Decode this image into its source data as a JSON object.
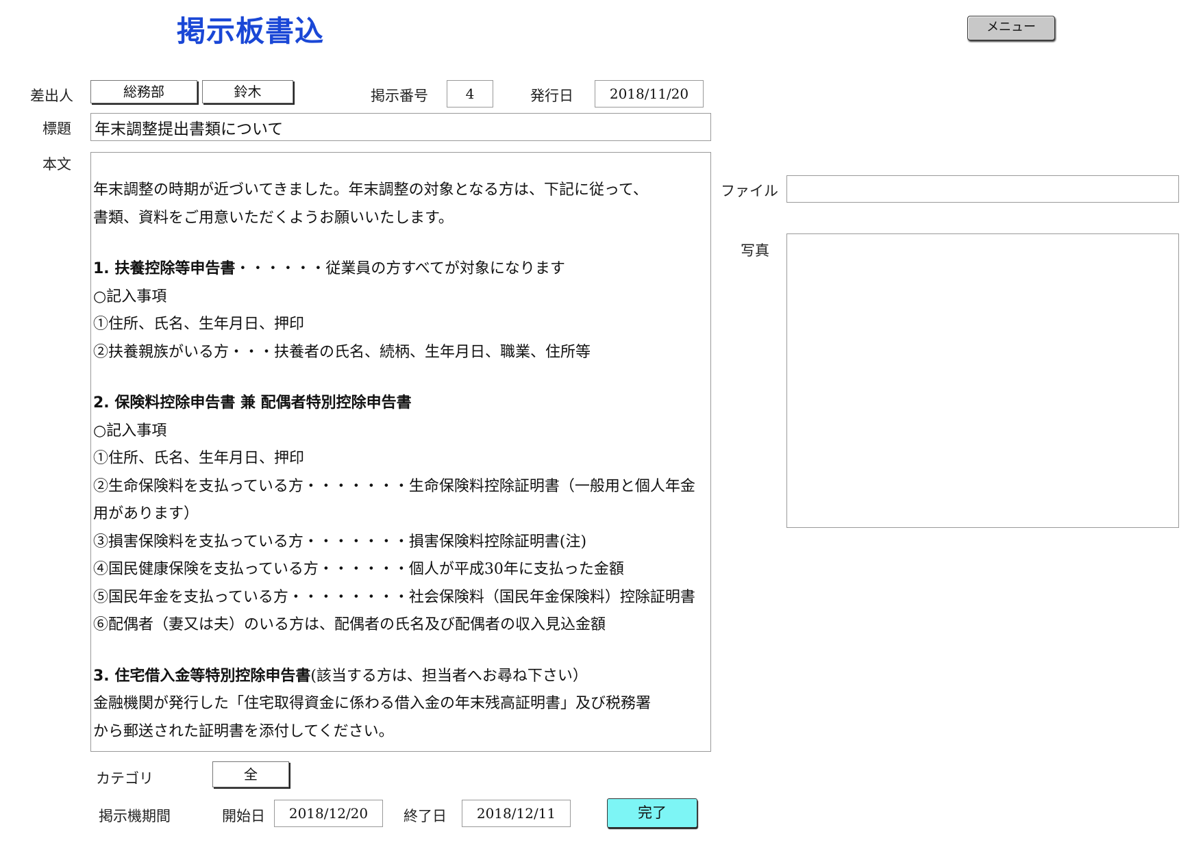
{
  "header": {
    "title": "掲示板書込",
    "menu_button": "メニュー"
  },
  "sender": {
    "label": "差出人",
    "department": "総務部",
    "name": "鈴木"
  },
  "post_number": {
    "label": "掲示番号",
    "value": "4"
  },
  "issue_date": {
    "label": "発行日",
    "value": "2018/11/20"
  },
  "subject": {
    "label": "標題",
    "value": "年末調整提出書類について"
  },
  "body": {
    "label": "本文",
    "lines": [
      "年末調整の時期が近づいてきました。年末調整の対象となる方は、下記に従って、",
      "書類、資料をご用意いただくようお願いいたします。",
      "",
      "1. 扶養控除等申告書・・・・・・従業員の方すべてが対象になります",
      "○記入事項",
      "①住所、氏名、生年月日、押印",
      "②扶養親族がいる方・・・扶養者の氏名、続柄、生年月日、職業、住所等",
      "",
      "2. 保険料控除申告書 兼 配偶者特別控除申告書",
      "○記入事項",
      "①住所、氏名、生年月日、押印",
      "②生命保険料を支払っている方・・・・・・・生命保険料控除証明書（一般用と個人年金",
      "用があります）",
      "③損害保険料を支払っている方・・・・・・・損害保険料控除証明書(注)",
      "④国民健康保険を支払っている方・・・・・・個人が平成30年に支払った金額",
      "⑤国民年金を支払っている方・・・・・・・・社会保険料（国民年金保険料）控除証明書",
      "⑥配偶者（妻又は夫）のいる方は、配偶者の氏名及び配偶者の収入見込金額",
      "",
      "3. 住宅借入金等特別控除申告書(該当する方は、担当者へお尋ね下さい）",
      " 金融機関が発行した「住宅取得資金に係わる借入金の年末残高証明書」及び税務署",
      "から郵送された証明書を添付してください。"
    ]
  },
  "file": {
    "label": "ファイル",
    "value": ""
  },
  "photo": {
    "label": "写真"
  },
  "category": {
    "label": "カテゴリ",
    "value": "全"
  },
  "period": {
    "label": "掲示機期間",
    "start_label": "開始日",
    "start_value": "2018/12/20",
    "end_label": "終了日",
    "end_value": "2018/12/11"
  },
  "done_button": "完了"
}
